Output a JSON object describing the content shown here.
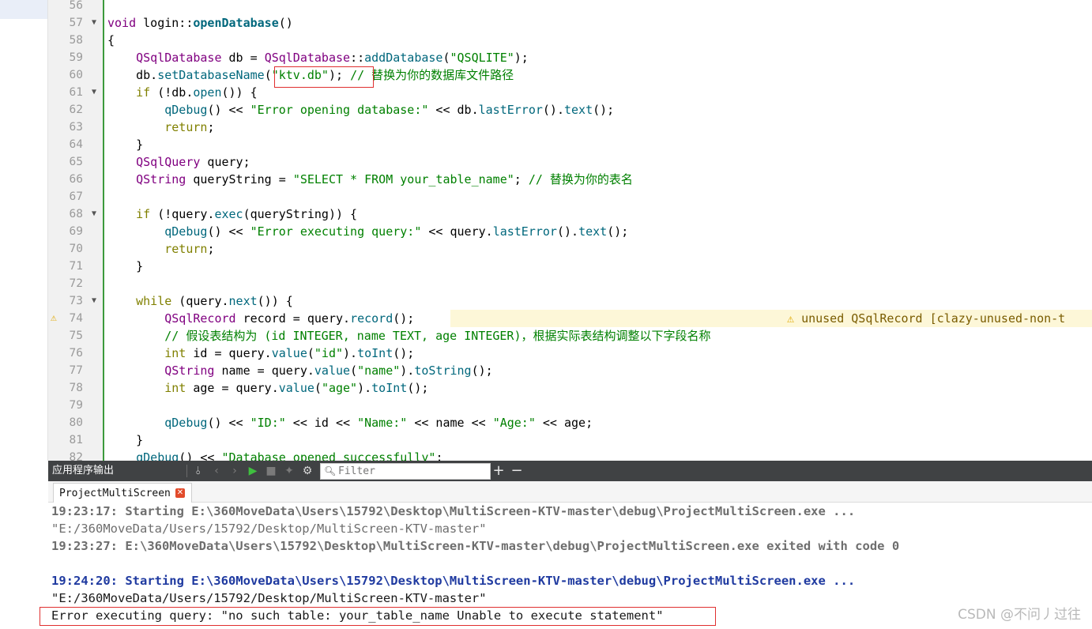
{
  "editor": {
    "lines": [
      {
        "n": "56",
        "tokens": []
      },
      {
        "n": "57",
        "fold": true,
        "tokens": [
          [
            "t",
            "void"
          ],
          [
            "o",
            " login::"
          ],
          [
            "fb",
            "openDatabase"
          ],
          [
            "o",
            "()"
          ]
        ]
      },
      {
        "n": "58",
        "tokens": [
          [
            "o",
            "{"
          ]
        ]
      },
      {
        "n": "59",
        "tokens": [
          [
            "o",
            "    "
          ],
          [
            "t",
            "QSqlDatabase"
          ],
          [
            "o",
            " db = "
          ],
          [
            "t",
            "QSqlDatabase"
          ],
          [
            "o",
            "::"
          ],
          [
            "f",
            "addDatabase"
          ],
          [
            "o",
            "("
          ],
          [
            "s",
            "\"QSQLITE\""
          ],
          [
            "o",
            ");"
          ]
        ]
      },
      {
        "n": "60",
        "tokens": [
          [
            "o",
            "    db."
          ],
          [
            "f",
            "setDatabaseName"
          ],
          [
            "o",
            "("
          ],
          [
            "s",
            "\"ktv.db\""
          ],
          [
            "o",
            "); "
          ],
          [
            "c",
            "// 替换为你的数据库文件路径"
          ]
        ]
      },
      {
        "n": "61",
        "fold": true,
        "tokens": [
          [
            "o",
            "    "
          ],
          [
            "k",
            "if"
          ],
          [
            "o",
            " (!db."
          ],
          [
            "f",
            "open"
          ],
          [
            "o",
            "()) {"
          ]
        ]
      },
      {
        "n": "62",
        "tokens": [
          [
            "o",
            "        "
          ],
          [
            "f",
            "qDebug"
          ],
          [
            "o",
            "() << "
          ],
          [
            "s",
            "\"Error opening database:\""
          ],
          [
            "o",
            " << db."
          ],
          [
            "f",
            "lastError"
          ],
          [
            "o",
            "()."
          ],
          [
            "f",
            "text"
          ],
          [
            "o",
            "();"
          ]
        ]
      },
      {
        "n": "63",
        "tokens": [
          [
            "o",
            "        "
          ],
          [
            "k",
            "return"
          ],
          [
            "o",
            ";"
          ]
        ]
      },
      {
        "n": "64",
        "tokens": [
          [
            "o",
            "    }"
          ]
        ]
      },
      {
        "n": "65",
        "tokens": [
          [
            "o",
            "    "
          ],
          [
            "t",
            "QSqlQuery"
          ],
          [
            "o",
            " query;"
          ]
        ]
      },
      {
        "n": "66",
        "tokens": [
          [
            "o",
            "    "
          ],
          [
            "t",
            "QString"
          ],
          [
            "o",
            " queryString = "
          ],
          [
            "s",
            "\"SELECT * FROM your_table_name\""
          ],
          [
            "o",
            "; "
          ],
          [
            "c",
            "// 替换为你的表名"
          ]
        ]
      },
      {
        "n": "67",
        "tokens": []
      },
      {
        "n": "68",
        "fold": true,
        "tokens": [
          [
            "o",
            "    "
          ],
          [
            "k",
            "if"
          ],
          [
            "o",
            " (!query."
          ],
          [
            "f",
            "exec"
          ],
          [
            "o",
            "(queryString)) {"
          ]
        ]
      },
      {
        "n": "69",
        "tokens": [
          [
            "o",
            "        "
          ],
          [
            "f",
            "qDebug"
          ],
          [
            "o",
            "() << "
          ],
          [
            "s",
            "\"Error executing query:\""
          ],
          [
            "o",
            " << query."
          ],
          [
            "f",
            "lastError"
          ],
          [
            "o",
            "()."
          ],
          [
            "f",
            "text"
          ],
          [
            "o",
            "();"
          ]
        ]
      },
      {
        "n": "70",
        "tokens": [
          [
            "o",
            "        "
          ],
          [
            "k",
            "return"
          ],
          [
            "o",
            ";"
          ]
        ]
      },
      {
        "n": "71",
        "tokens": [
          [
            "o",
            "    }"
          ]
        ]
      },
      {
        "n": "72",
        "tokens": []
      },
      {
        "n": "73",
        "fold": true,
        "tokens": [
          [
            "o",
            "    "
          ],
          [
            "k",
            "while"
          ],
          [
            "o",
            " (query."
          ],
          [
            "f",
            "next"
          ],
          [
            "o",
            "()) {"
          ]
        ]
      },
      {
        "n": "74",
        "warn": true,
        "tokens": [
          [
            "o",
            "        "
          ],
          [
            "t",
            "QSqlRecord"
          ],
          [
            "o",
            " record = query."
          ],
          [
            "f",
            "record"
          ],
          [
            "o",
            "();"
          ]
        ]
      },
      {
        "n": "75",
        "tokens": [
          [
            "o",
            "        "
          ],
          [
            "c",
            "// 假设表结构为 (id INTEGER, name TEXT, age INTEGER)，根据实际表结构调整以下字段名称"
          ]
        ]
      },
      {
        "n": "76",
        "tokens": [
          [
            "o",
            "        "
          ],
          [
            "k",
            "int"
          ],
          [
            "o",
            " id = query."
          ],
          [
            "f",
            "value"
          ],
          [
            "o",
            "("
          ],
          [
            "s",
            "\"id\""
          ],
          [
            "o",
            ")."
          ],
          [
            "f",
            "toInt"
          ],
          [
            "o",
            "();"
          ]
        ]
      },
      {
        "n": "77",
        "tokens": [
          [
            "o",
            "        "
          ],
          [
            "t",
            "QString"
          ],
          [
            "o",
            " name = query."
          ],
          [
            "f",
            "value"
          ],
          [
            "o",
            "("
          ],
          [
            "s",
            "\"name\""
          ],
          [
            "o",
            ")."
          ],
          [
            "f",
            "toString"
          ],
          [
            "o",
            "();"
          ]
        ]
      },
      {
        "n": "78",
        "tokens": [
          [
            "o",
            "        "
          ],
          [
            "k",
            "int"
          ],
          [
            "o",
            " age = query."
          ],
          [
            "f",
            "value"
          ],
          [
            "o",
            "("
          ],
          [
            "s",
            "\"age\""
          ],
          [
            "o",
            ")."
          ],
          [
            "f",
            "toInt"
          ],
          [
            "o",
            "();"
          ]
        ]
      },
      {
        "n": "79",
        "tokens": []
      },
      {
        "n": "80",
        "tokens": [
          [
            "o",
            "        "
          ],
          [
            "f",
            "qDebug"
          ],
          [
            "o",
            "() << "
          ],
          [
            "s",
            "\"ID:\""
          ],
          [
            "o",
            " << id << "
          ],
          [
            "s",
            "\"Name:\""
          ],
          [
            "o",
            " << name << "
          ],
          [
            "s",
            "\"Age:\""
          ],
          [
            "o",
            " << age;"
          ]
        ]
      },
      {
        "n": "81",
        "tokens": [
          [
            "o",
            "    }"
          ]
        ]
      },
      {
        "n": "82",
        "tokens": [
          [
            "o",
            "    "
          ],
          [
            "f",
            "qDebug"
          ],
          [
            "o",
            "() << "
          ],
          [
            "s",
            "\"Database opened successfully\""
          ],
          [
            "o",
            ";"
          ]
        ]
      }
    ],
    "warning": {
      "icon": "warning-icon",
      "text": "unused QSqlRecord [clazy-unused-non-t"
    }
  },
  "pane": {
    "title": "应用程序输出",
    "filter_placeholder": "Filter",
    "tab_label": "ProjectMultiScreen"
  },
  "output": {
    "lines": [
      {
        "style": "grayb",
        "text": "19:23:17: Starting E:\\360MoveData\\Users\\15792\\Desktop\\MultiScreen-KTV-master\\debug\\ProjectMultiScreen.exe ..."
      },
      {
        "style": "gray",
        "text": "\"E:/360MoveData/Users/15792/Desktop/MultiScreen-KTV-master\""
      },
      {
        "style": "grayb",
        "text": "19:23:27: E:\\360MoveData\\Users\\15792\\Desktop\\MultiScreen-KTV-master\\debug\\ProjectMultiScreen.exe exited with code 0"
      },
      {
        "style": "gray",
        "text": ""
      },
      {
        "style": "blueb",
        "text": "19:24:20: Starting E:\\360MoveData\\Users\\15792\\Desktop\\MultiScreen-KTV-master\\debug\\ProjectMultiScreen.exe ..."
      },
      {
        "style": "dark",
        "text": "\"E:/360MoveData/Users/15792/Desktop/MultiScreen-KTV-master\""
      },
      {
        "style": "dark",
        "text": "Error executing query: \"no such table: your_table_name Unable to execute statement\""
      }
    ]
  },
  "watermark": "CSDN @不问丿过往"
}
